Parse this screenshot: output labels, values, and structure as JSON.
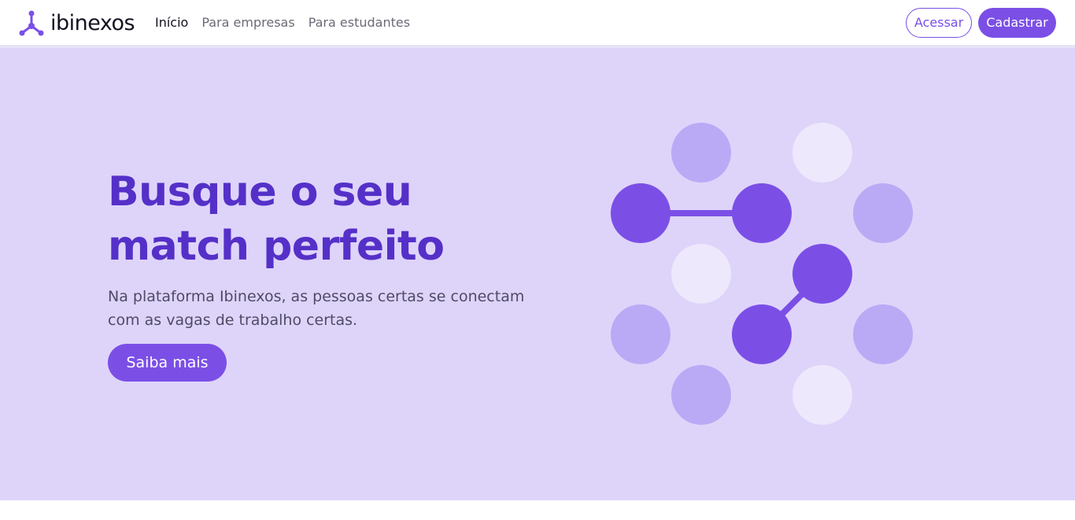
{
  "brand": {
    "name": "ibinexos",
    "accent_color": "#7b4fe6",
    "icon": "molecule-logo-icon"
  },
  "nav": {
    "links": [
      {
        "label": "Início",
        "active": true
      },
      {
        "label": "Para empresas",
        "active": false
      },
      {
        "label": "Para estudantes",
        "active": false
      }
    ]
  },
  "auth": {
    "login_label": "Acessar",
    "signup_label": "Cadastrar"
  },
  "hero": {
    "title_line1": "Busque o seu",
    "title_line2": "match perfeito",
    "subtitle": "Na plataforma Ibinexos, as pessoas certas se conectam com as vagas de trabalho certas.",
    "cta_label": "Saiba mais",
    "background_color": "#ded4fa",
    "title_color": "#5530c8"
  },
  "illustration": {
    "icon": "connected-dots-illustration"
  }
}
